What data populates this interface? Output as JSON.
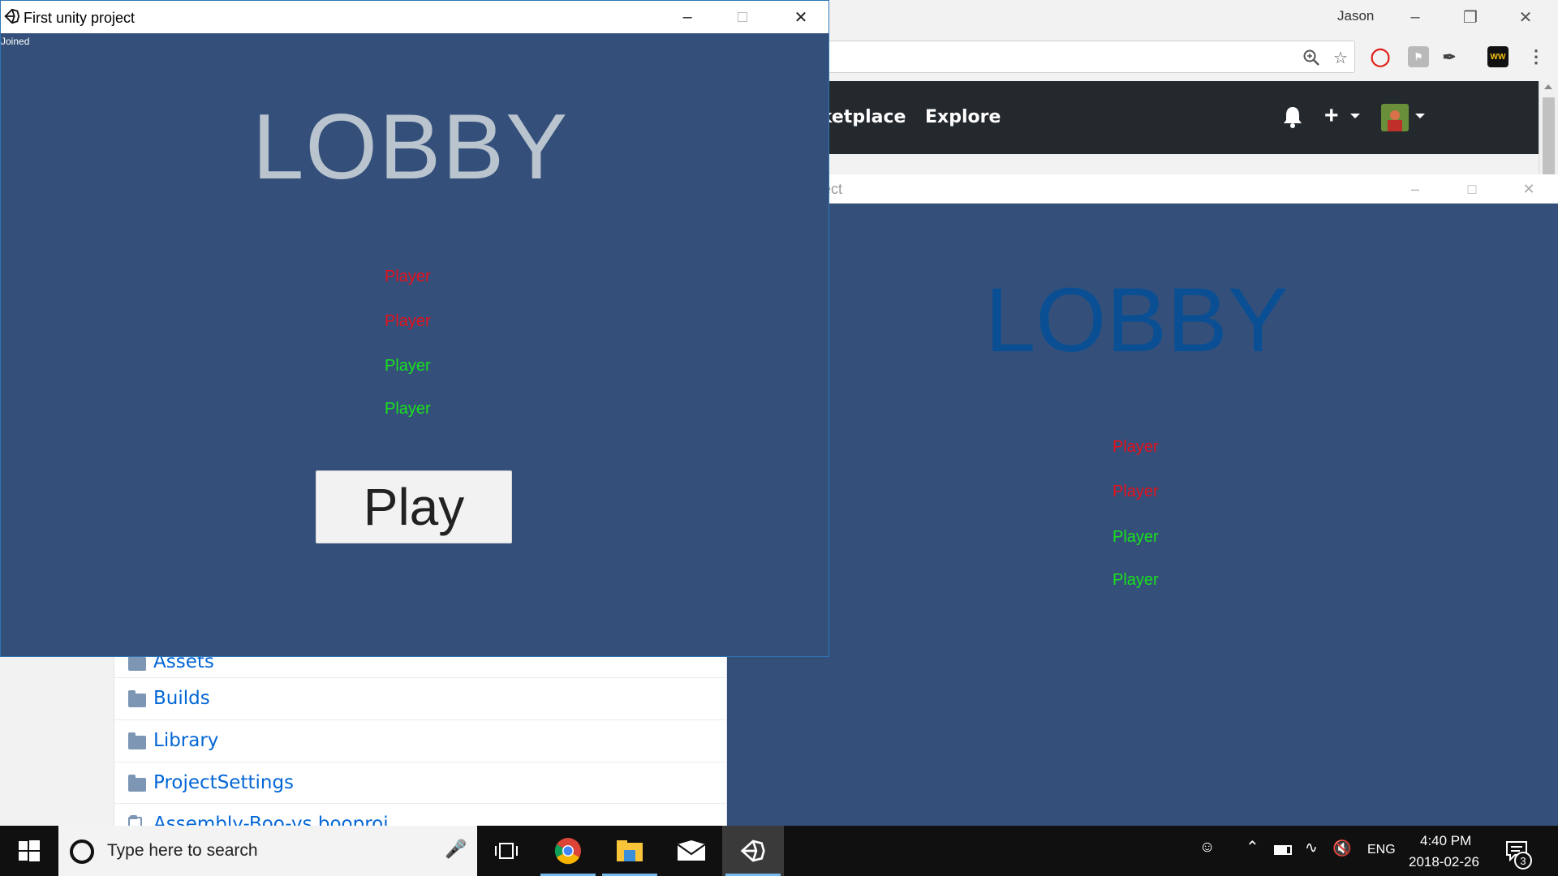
{
  "chrome": {
    "user_name": "Jason",
    "nav": {
      "marketplace": "rketplace",
      "explore": "Explore"
    },
    "files": [
      "Assets",
      "Builds",
      "Library",
      "ProjectSettings",
      "Assembly-Boo-vs.booproj"
    ]
  },
  "unity_main": {
    "title": "First unity project",
    "status": "Joined",
    "lobby": "LOBBY",
    "players": [
      {
        "label": "Player",
        "color": "#e8101a"
      },
      {
        "label": "Player",
        "color": "#e8101a"
      },
      {
        "label": "Player",
        "color": "#19e11d"
      },
      {
        "label": "Player",
        "color": "#19e11d"
      }
    ],
    "play_label": "Play"
  },
  "unity_second": {
    "title": "roject",
    "lobby": "LOBBY",
    "players": [
      {
        "label": "Player",
        "color": "#e8101a"
      },
      {
        "label": "Player",
        "color": "#e8101a"
      },
      {
        "label": "Player",
        "color": "#19e11d"
      },
      {
        "label": "Player",
        "color": "#19e11d"
      }
    ]
  },
  "taskbar": {
    "search_placeholder": "Type here to search",
    "language": "ENG",
    "time": "4:40 PM",
    "date": "2018-02-26",
    "notification_count": "3"
  }
}
